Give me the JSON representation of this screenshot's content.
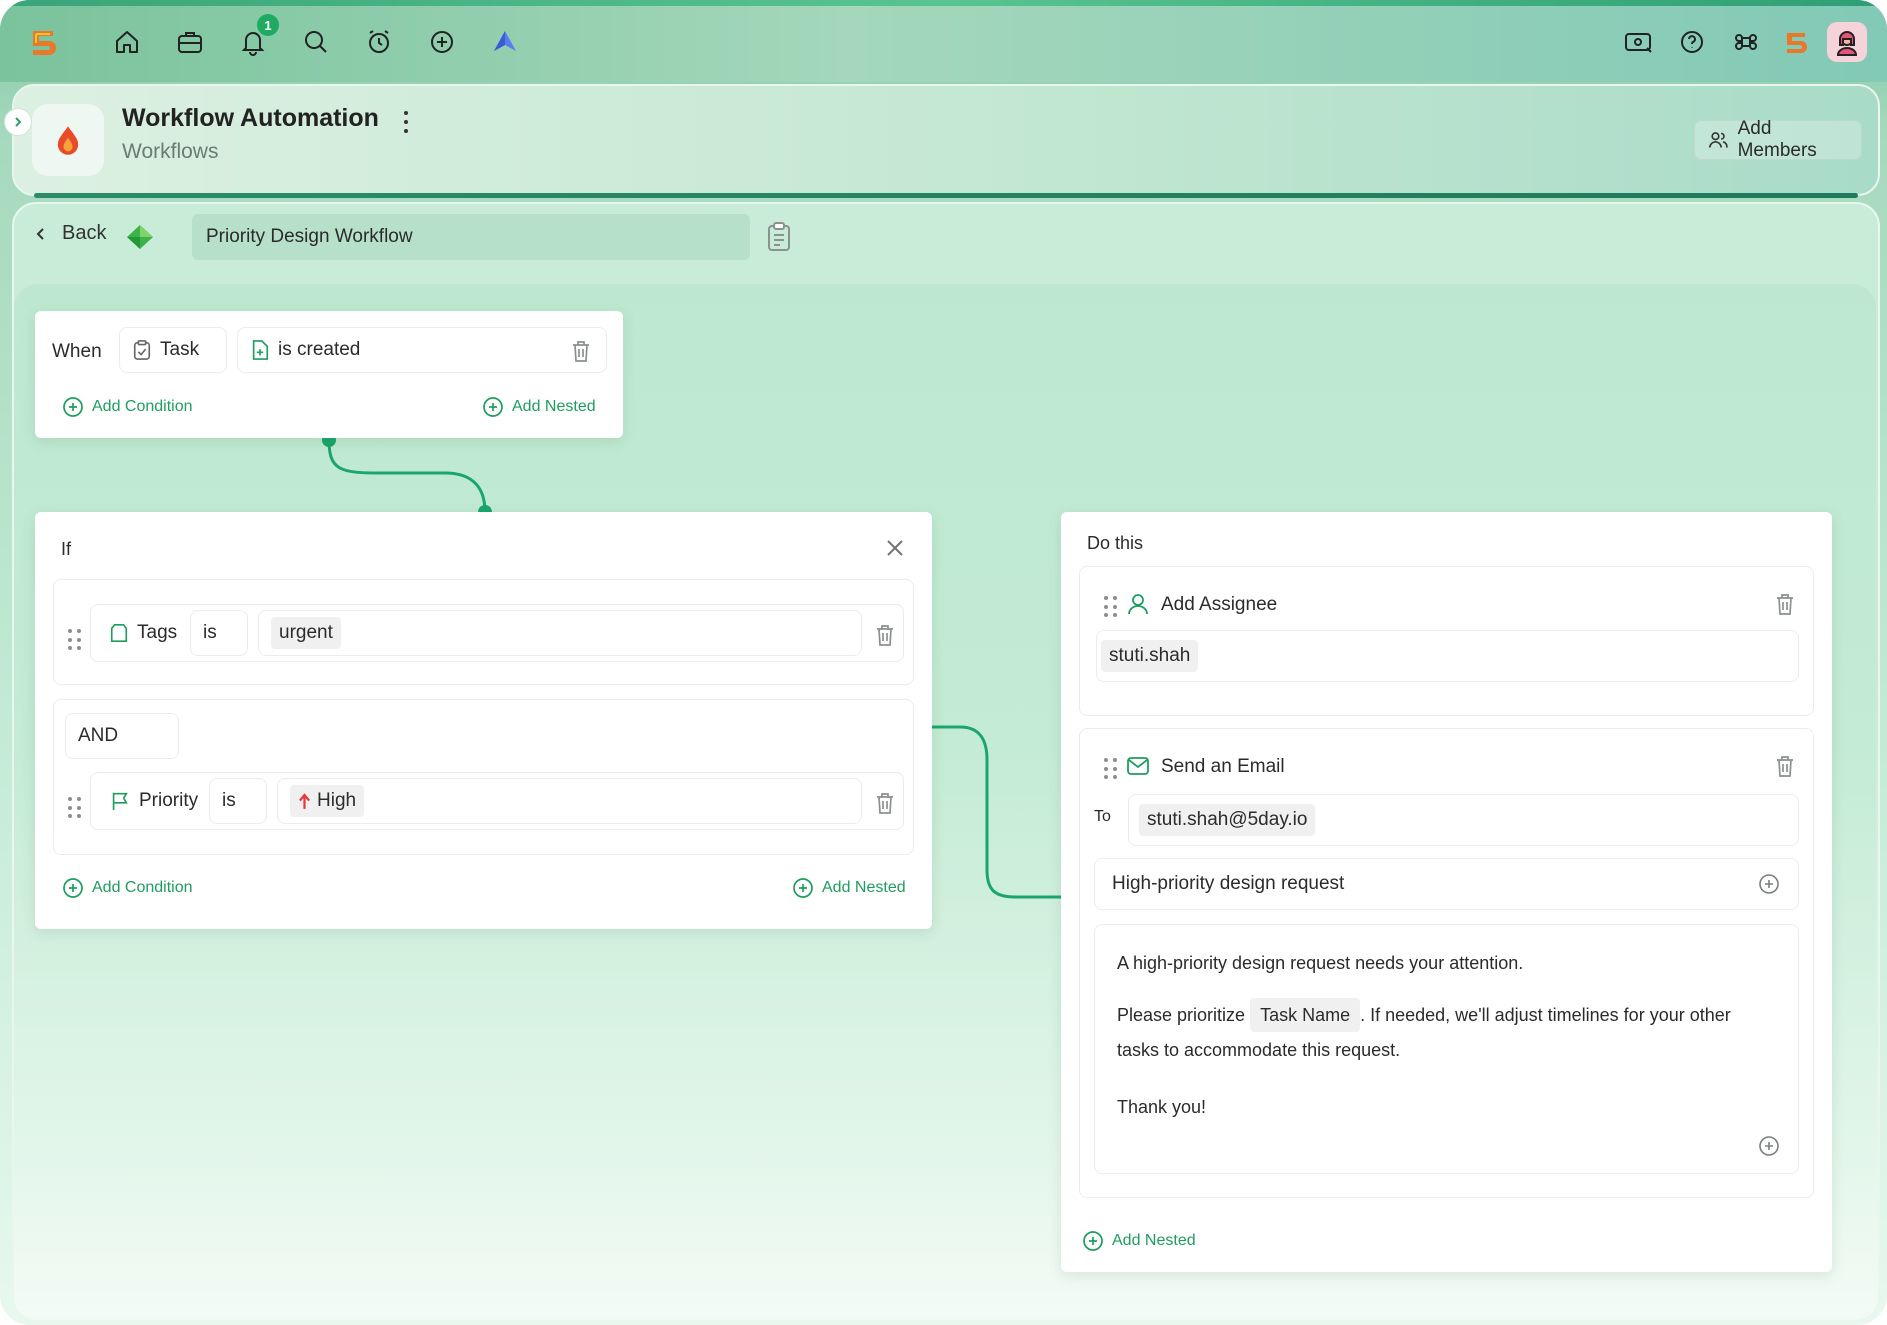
{
  "topbar": {
    "notification_count": "1",
    "icons": [
      "home-icon",
      "briefcase-icon",
      "bell-icon",
      "search-icon",
      "alarm-icon",
      "plus-circle-icon",
      "app-icon",
      "billing-icon",
      "help-icon",
      "command-icon",
      "brand-icon",
      "avatar"
    ]
  },
  "header": {
    "title": "Workflow Automation",
    "subtitle": "Workflows",
    "add_members_label": "Add Members"
  },
  "toolbar": {
    "back_label": "Back",
    "workflow_name": "Priority Design Workflow"
  },
  "trigger": {
    "when_label": "When",
    "entity": "Task",
    "event": "is created",
    "add_condition": "Add Condition",
    "add_nested": "Add Nested"
  },
  "conditions": {
    "if_label": "If",
    "rows": [
      {
        "field": "Tags",
        "operator": "is",
        "value": "urgent"
      },
      {
        "field": "Priority",
        "operator": "is",
        "value": "High"
      }
    ],
    "joiner": "AND",
    "add_condition": "Add Condition",
    "add_nested": "Add Nested"
  },
  "actions": {
    "do_label": "Do this",
    "assignee": {
      "title": "Add Assignee",
      "value": "stuti.shah"
    },
    "email": {
      "title": "Send an Email",
      "to_label": "To",
      "to_value": "stuti.shah@5day.io",
      "subject": "High-priority design request",
      "body_line1": "A high-priority design request needs your attention.",
      "body_line2_prefix": "Please prioritize",
      "body_token": "Task Name",
      "body_line2_suffix": ". If needed, we'll adjust timelines for your other",
      "body_line3": "tasks to accommodate this request.",
      "body_line4": "Thank you!"
    },
    "add_nested": "Add Nested"
  },
  "colors": {
    "accent": "#1e9e5e",
    "connector": "#1aa66a",
    "priority_high": "#e53a3a"
  }
}
